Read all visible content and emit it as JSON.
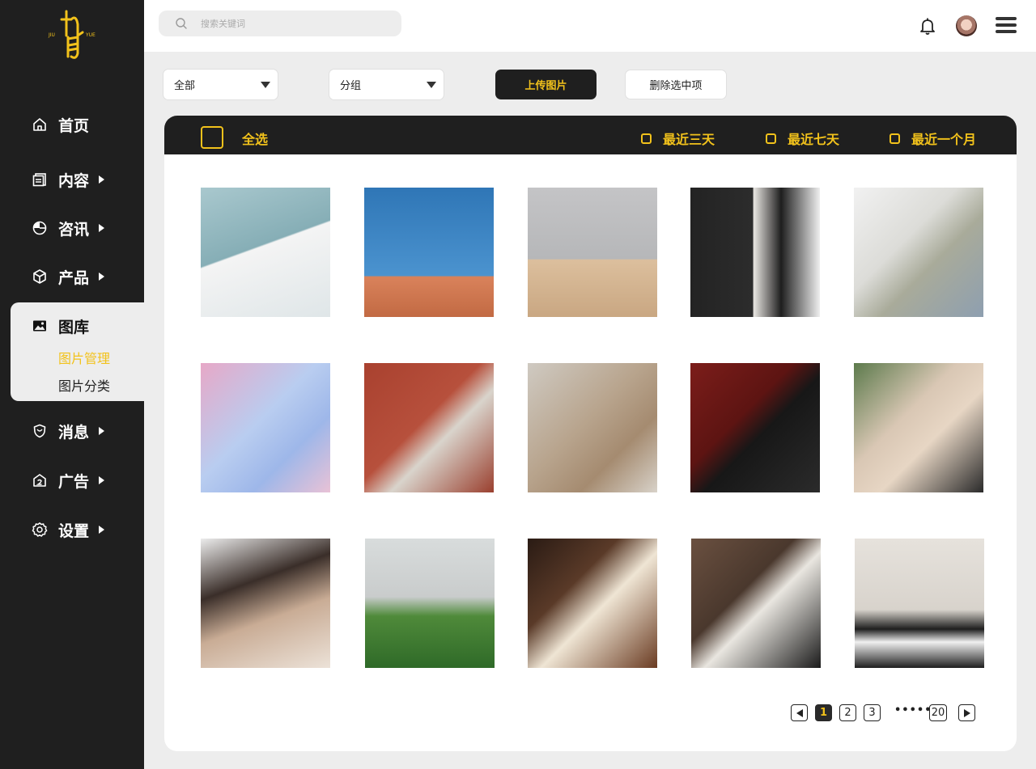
{
  "brand": {
    "logo_left": "JIU",
    "logo_right": "YUE",
    "accent": "#f2c21b",
    "dark": "#1f1f1f"
  },
  "sidebar": {
    "items": [
      {
        "label": "首页",
        "icon": "home-icon"
      },
      {
        "label": "内容",
        "icon": "document-icon"
      },
      {
        "label": "咨讯",
        "icon": "pie-chart-icon"
      },
      {
        "label": "产品",
        "icon": "box-icon"
      },
      {
        "label": "图库",
        "icon": "image-icon"
      },
      {
        "label": "消息",
        "icon": "shield-icon"
      },
      {
        "label": "广告",
        "icon": "ad-icon"
      },
      {
        "label": "设置",
        "icon": "gear-icon"
      }
    ],
    "gallery_sub": [
      {
        "label": "图片管理",
        "active": true
      },
      {
        "label": "图片分类",
        "active": false
      }
    ]
  },
  "topbar": {
    "search_placeholder": "搜索关键词"
  },
  "filters": {
    "select_all_value": "全部",
    "group_value": "分组",
    "upload_label": "上传图片",
    "delete_label": "删除选中项"
  },
  "panel": {
    "select_all": "全选",
    "periods": [
      "最近三天",
      "最近七天",
      "最近一个月"
    ]
  },
  "gallery": {
    "images": [
      "wedding-dress-photo",
      "athletes-on-dune-photo",
      "man-in-desert-photo",
      "couple-black-outfits-photo",
      "woman-grey-suit-photo",
      "pastel-floral-couple-photo",
      "satin-jacket-woman-photo",
      "beige-sweater-man-photo",
      "black-sequin-woman-photo",
      "woman-statement-necklace-photo",
      "woman-camisole-photo",
      "woman-on-grass-hill-photo",
      "woman-by-piano-photo",
      "woman-on-stairs-photo",
      "woman-leather-jacket-photo"
    ]
  },
  "pagination": {
    "pages": [
      "1",
      "2",
      "3"
    ],
    "ellipsis": "••••••",
    "last": "20",
    "current": "1"
  }
}
